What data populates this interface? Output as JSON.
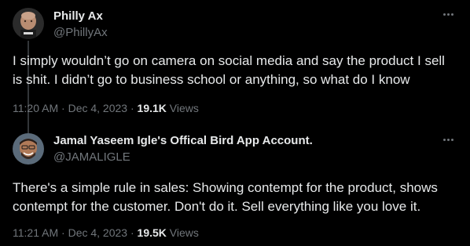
{
  "tweets": [
    {
      "display_name": "Philly Ax",
      "handle": "@PhillyAx",
      "text": "I simply wouldn’t go on camera on social media and say the product I sell is shit. I didn’t go to business school or anything, so what do I know",
      "time": "11:20 AM",
      "sep1": " · ",
      "date": "Dec 4, 2023",
      "sep2": " · ",
      "views_count": "19.1K",
      "views_label": " Views",
      "avatar_icon": "profile-avatar-bald-man"
    },
    {
      "display_name": "Jamal Yaseem Igle's Offical Bird App Account.",
      "handle": "@JAMALIGLE",
      "text": "There's a simple rule in sales: Showing contempt for the product, shows contempt for the customer. Don't do it. Sell everything like you love it.",
      "time": "11:21 AM",
      "sep1": " · ",
      "date": "Dec 4, 2023",
      "sep2": " · ",
      "views_count": "19.5K",
      "views_label": " Views",
      "avatar_icon": "profile-avatar-smiling-man"
    }
  ],
  "colors": {
    "background": "#000000",
    "primary_text": "#e7e9ea",
    "secondary_text": "#71767b",
    "connector": "#333639"
  }
}
